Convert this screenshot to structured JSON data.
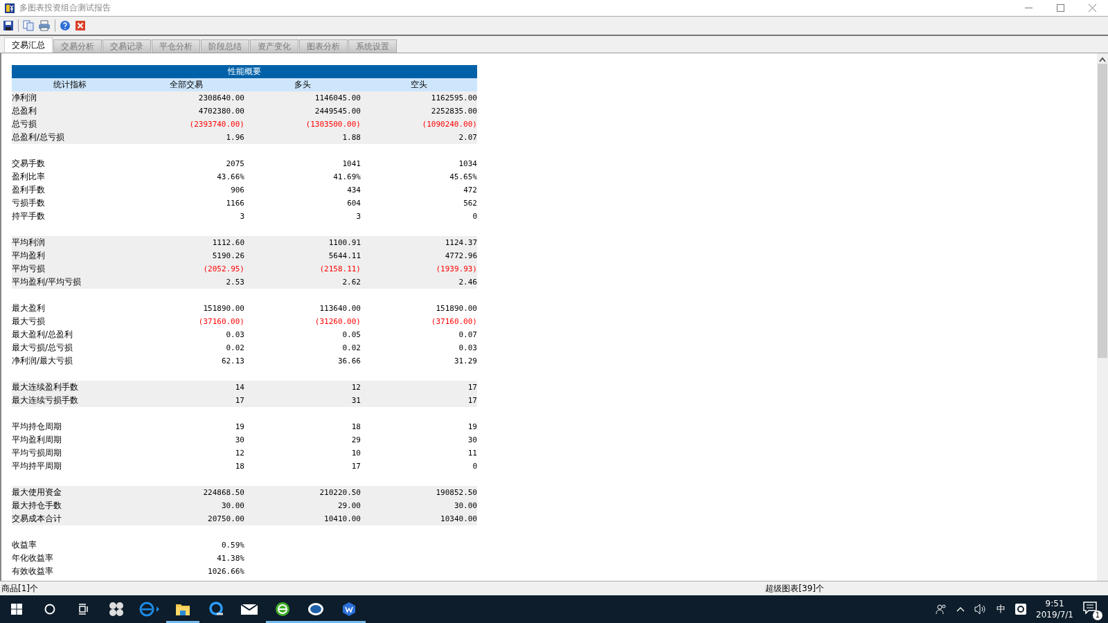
{
  "window": {
    "title": "多图表投资组合测试报告"
  },
  "tabs": [
    {
      "label": "交易汇总",
      "selected": true
    },
    {
      "label": "交易分析",
      "selected": false
    },
    {
      "label": "交易记录",
      "selected": false
    },
    {
      "label": "平仓分析",
      "selected": false
    },
    {
      "label": "阶段总结",
      "selected": false
    },
    {
      "label": "资产变化",
      "selected": false
    },
    {
      "label": "图表分析",
      "selected": false
    },
    {
      "label": "系统设置",
      "selected": false
    }
  ],
  "report": {
    "title": "性能概要",
    "columns": [
      "统计指标",
      "全部交易",
      "多头",
      "空头"
    ],
    "groups": [
      {
        "shaded": true,
        "rows": [
          {
            "label": "净利润",
            "values": [
              "2308640.00",
              "1146045.00",
              "1162595.00"
            ],
            "loss": false
          },
          {
            "label": "总盈利",
            "values": [
              "4702380.00",
              "2449545.00",
              "2252835.00"
            ],
            "loss": false
          },
          {
            "label": "总亏损",
            "values": [
              "(2393740.00)",
              "(1303500.00)",
              "(1090240.00)"
            ],
            "loss": true
          },
          {
            "label": "总盈利/总亏损",
            "values": [
              "1.96",
              "1.88",
              "2.07"
            ],
            "loss": false
          }
        ]
      },
      {
        "shaded": false,
        "rows": [
          {
            "label": "交易手数",
            "values": [
              "2075",
              "1041",
              "1034"
            ],
            "loss": false
          },
          {
            "label": "盈利比率",
            "values": [
              "43.66%",
              "41.69%",
              "45.65%"
            ],
            "loss": false
          },
          {
            "label": "盈利手数",
            "values": [
              "906",
              "434",
              "472"
            ],
            "loss": false
          },
          {
            "label": "亏损手数",
            "values": [
              "1166",
              "604",
              "562"
            ],
            "loss": false
          },
          {
            "label": "持平手数",
            "values": [
              "3",
              "3",
              "0"
            ],
            "loss": false
          }
        ]
      },
      {
        "shaded": true,
        "rows": [
          {
            "label": "平均利润",
            "values": [
              "1112.60",
              "1100.91",
              "1124.37"
            ],
            "loss": false
          },
          {
            "label": "平均盈利",
            "values": [
              "5190.26",
              "5644.11",
              "4772.96"
            ],
            "loss": false
          },
          {
            "label": "平均亏损",
            "values": [
              "(2052.95)",
              "(2158.11)",
              "(1939.93)"
            ],
            "loss": true
          },
          {
            "label": "平均盈利/平均亏损",
            "values": [
              "2.53",
              "2.62",
              "2.46"
            ],
            "loss": false
          }
        ]
      },
      {
        "shaded": false,
        "rows": [
          {
            "label": "最大盈利",
            "values": [
              "151890.00",
              "113640.00",
              "151890.00"
            ],
            "loss": false
          },
          {
            "label": "最大亏损",
            "values": [
              "(37160.00)",
              "(31260.00)",
              "(37160.00)"
            ],
            "loss": true
          },
          {
            "label": "最大盈利/总盈利",
            "values": [
              "0.03",
              "0.05",
              "0.07"
            ],
            "loss": false
          },
          {
            "label": "最大亏损/总亏损",
            "values": [
              "0.02",
              "0.02",
              "0.03"
            ],
            "loss": false
          },
          {
            "label": "净利润/最大亏损",
            "values": [
              "62.13",
              "36.66",
              "31.29"
            ],
            "loss": false
          }
        ]
      },
      {
        "shaded": true,
        "rows": [
          {
            "label": "最大连续盈利手数",
            "values": [
              "14",
              "12",
              "17"
            ],
            "loss": false
          },
          {
            "label": "最大连续亏损手数",
            "values": [
              "17",
              "31",
              "17"
            ],
            "loss": false
          }
        ]
      },
      {
        "shaded": false,
        "rows": [
          {
            "label": "平均持仓周期",
            "values": [
              "19",
              "18",
              "19"
            ],
            "loss": false
          },
          {
            "label": "平均盈利周期",
            "values": [
              "30",
              "29",
              "30"
            ],
            "loss": false
          },
          {
            "label": "平均亏损周期",
            "values": [
              "12",
              "10",
              "11"
            ],
            "loss": false
          },
          {
            "label": "平均持平周期",
            "values": [
              "18",
              "17",
              "0"
            ],
            "loss": false
          }
        ]
      },
      {
        "shaded": true,
        "rows": [
          {
            "label": "最大使用资金",
            "values": [
              "224868.50",
              "210220.50",
              "190852.50"
            ],
            "loss": false
          },
          {
            "label": "最大持仓手数",
            "values": [
              "30.00",
              "29.00",
              "30.00"
            ],
            "loss": false
          },
          {
            "label": "交易成本合计",
            "values": [
              "20750.00",
              "10410.00",
              "10340.00"
            ],
            "loss": false
          }
        ]
      },
      {
        "shaded": false,
        "rows": [
          {
            "label": "收益率",
            "values": [
              "0.59%"
            ],
            "loss": false
          },
          {
            "label": "年化收益率",
            "values": [
              "41.38%"
            ],
            "loss": false
          },
          {
            "label": "有效收益率",
            "values": [
              "1026.66%"
            ],
            "loss": false
          }
        ]
      }
    ]
  },
  "status_bar": {
    "left": "商品[1]个",
    "right": "超级图表[39]个"
  },
  "taskbar": {
    "apps": [
      {
        "kind": "pinwheel",
        "open": false
      },
      {
        "kind": "browser",
        "open": false
      },
      {
        "kind": "folder",
        "open": true
      },
      {
        "kind": "qbrowser",
        "open": false
      },
      {
        "kind": "mail",
        "open": false
      },
      {
        "kind": "greenapp",
        "open": true
      },
      {
        "kind": "tbapp",
        "open": true
      },
      {
        "kind": "wapp",
        "open": true
      }
    ],
    "ime": "中",
    "time": "9:51",
    "date": "2019/7/1",
    "notifications": "1"
  }
}
